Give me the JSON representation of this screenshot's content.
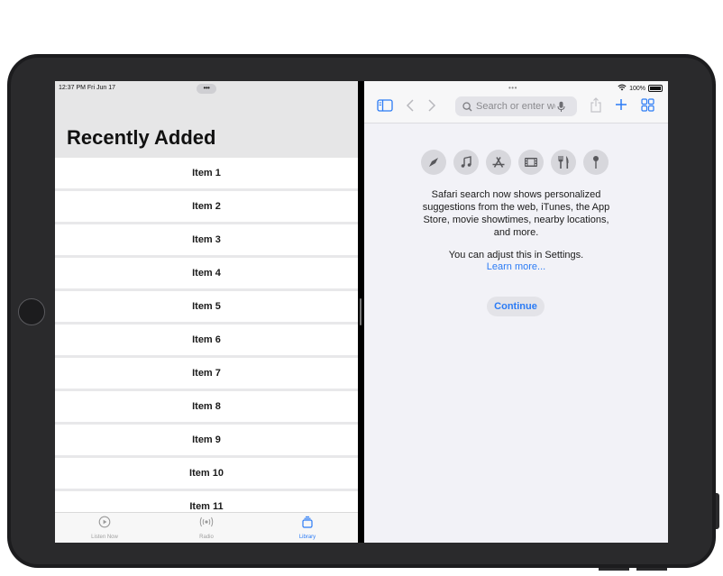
{
  "left": {
    "status_time": "12:37 PM  Fri Jun 17",
    "multitask_dots": "•••",
    "title": "Recently Added",
    "items": [
      "Item 1",
      "Item 2",
      "Item 3",
      "Item 4",
      "Item 5",
      "Item 6",
      "Item 7",
      "Item 8",
      "Item 9",
      "Item 10",
      "Item 11"
    ],
    "tabs": [
      {
        "label": "Listen Now",
        "icon": "play-circle-icon",
        "active": false
      },
      {
        "label": "Radio",
        "icon": "radio-waves-icon",
        "active": false
      },
      {
        "label": "Library",
        "icon": "library-stack-icon",
        "active": true
      }
    ]
  },
  "right": {
    "multitask_dots": "•••",
    "battery": "100%",
    "search_placeholder": "Search or enter website name",
    "suggestion_icons": [
      "compass-icon",
      "music-note-icon",
      "app-store-icon",
      "film-icon",
      "fork-knife-icon",
      "map-pin-icon"
    ],
    "message": "Safari search now shows personalized suggestions from the web, iTunes, the App Store, movie showtimes, nearby locations, and more.",
    "settings_note": "You can adjust this in Settings.",
    "learn_more": "Learn more...",
    "continue_label": "Continue"
  },
  "colors": {
    "accent": "#2b7bf5",
    "background": "#f2f2f7"
  }
}
